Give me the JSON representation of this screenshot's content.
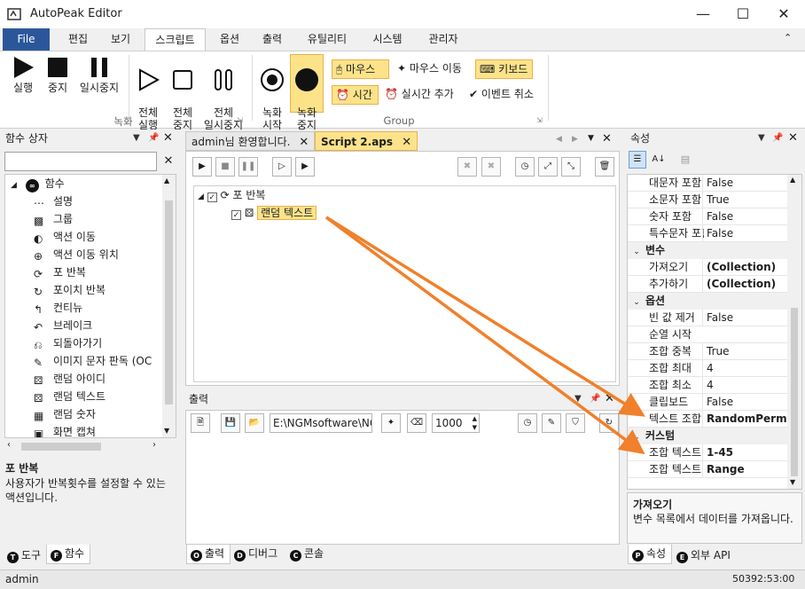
{
  "app": {
    "title": "AutoPeak Editor"
  },
  "ribbon_tabs": [
    "File",
    "편집",
    "보기",
    "스크립트",
    "옵션",
    "출력",
    "유틸리티",
    "시스템",
    "관리자"
  ],
  "ribbon": {
    "record_group": "녹화",
    "group_group": "Group",
    "buttons": {
      "run": "실행",
      "stop": "중지",
      "pause": "일시중지",
      "run_all": "전체\n실행",
      "stop_all": "전체\n중지",
      "pause_all": "전체\n일시중지",
      "rec_start": "녹화\n시작",
      "rec_stop": "녹화\n중지"
    },
    "small": {
      "mouse": "마우스",
      "mouse_move": "마우스 이동",
      "keyboard": "키보드",
      "time": "시간",
      "realtime_add": "실시간 추가",
      "event_cancel": "이벤트 취소"
    }
  },
  "function_box": {
    "title": "함수 상자",
    "search_placeholder": "",
    "root": "함수",
    "items": [
      "설명",
      "그룹",
      "액션 이동",
      "액션 이동 위치",
      "포 반복",
      "포이치 반복",
      "컨티뉴",
      "브레이크",
      "되돌아가기",
      "이미지 문자 판독 (OC",
      "랜덤 아이디",
      "랜덤 텍스트",
      "랜덤 숫자",
      "화면 캡쳐"
    ],
    "desc_title": "포 반복",
    "desc_text": "사용자가 반복횟수를 설정할 수 있는 액션입니다.",
    "tabs": [
      "도구",
      "함수"
    ]
  },
  "editor": {
    "tabs": [
      "admin님 환영합니다.",
      "Script 2.aps"
    ],
    "tree": {
      "loop": "포 반복",
      "child": "랜덤 텍스트"
    }
  },
  "output": {
    "title": "출력",
    "path": "E:\\NGMsoftware\\NG",
    "count": "1000",
    "tabs": [
      "출력",
      "디버그",
      "콘솔"
    ]
  },
  "properties": {
    "title": "속성",
    "rows_top": [
      {
        "name": "대문자 포함",
        "value": "False"
      },
      {
        "name": "소문자 포함",
        "value": "True"
      },
      {
        "name": "숫자 포함",
        "value": "False"
      },
      {
        "name": "특수문자 포함",
        "value": "False"
      }
    ],
    "cat_var": "변수",
    "rows_var": [
      {
        "name": "가져오기",
        "value": "(Collection)"
      },
      {
        "name": "추가하기",
        "value": "(Collection)"
      }
    ],
    "cat_opt": "옵션",
    "rows_opt": [
      {
        "name": "빈 값 제거",
        "value": "False"
      },
      {
        "name": "순열 시작",
        "value": ""
      },
      {
        "name": "조합 중복",
        "value": "True"
      },
      {
        "name": "조합 최대",
        "value": "4"
      },
      {
        "name": "조합 최소",
        "value": "4"
      },
      {
        "name": "클립보드",
        "value": "False"
      },
      {
        "name": "텍스트 조합",
        "value": "RandomPermuta"
      }
    ],
    "cat_custom": "커스텀",
    "rows_custom": [
      {
        "name": "조합 텍스트",
        "value": "1-45"
      },
      {
        "name": "조합 텍스트",
        "value": "Range"
      }
    ],
    "desc_title": "가져오기",
    "desc_text": "변수 목록에서 데이터를 가져옵니다.",
    "tabs": [
      "속성",
      "외부 API"
    ]
  },
  "statusbar": {
    "user": "admin",
    "time": "50392:53:00"
  },
  "colors": {
    "file_tab": "#2b579a",
    "highlight": "#fce38a",
    "arrow": "#f0802b"
  }
}
